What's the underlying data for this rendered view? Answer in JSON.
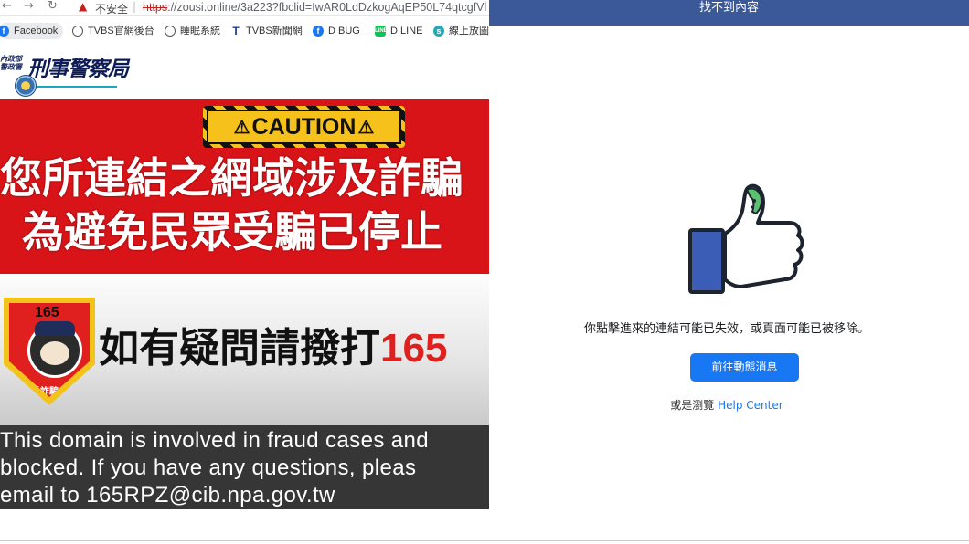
{
  "browser": {
    "insecure_label": "不安全",
    "url_scheme": "https",
    "url_rest": "://zousi.online/3a223?fbclid=IwAR0LdDzkogAqEP50L74qtcgfVl",
    "bookmarks": [
      "Facebook",
      "TVBS官網後台",
      "睡眠系統",
      "TVBS新聞網",
      "D BUG",
      "D LINE",
      "線上放圖"
    ]
  },
  "police": {
    "org_small": "內政部\n警政署",
    "org_name": "刑事警察局"
  },
  "warning": {
    "caution": "CAUTION",
    "line1": "您所連結之網域涉及詐騙",
    "line2": "為避免民眾受騙已停止",
    "badge_number": "165",
    "badge_label": "反詐騙",
    "call_text": "如有疑問請撥打",
    "call_number": "165",
    "en_lines": [
      "This domain is involved in fraud cases and",
      "blocked. If you have any questions, pleas",
      "email to 165RPZ@cib.npa.gov.tw"
    ]
  },
  "facebook": {
    "header": "找不到內容",
    "message": "你點擊進來的連結可能已失效，或頁面可能已被移除。",
    "button": "前往動態消息",
    "browse_prefix": "或是瀏覽 ",
    "browse_link": "Help Center"
  },
  "colors": {
    "fb_blue": "#1877f2",
    "fb_header": "#3b5998",
    "warning_red": "#d81419",
    "caution_yellow": "#f6c11b"
  }
}
